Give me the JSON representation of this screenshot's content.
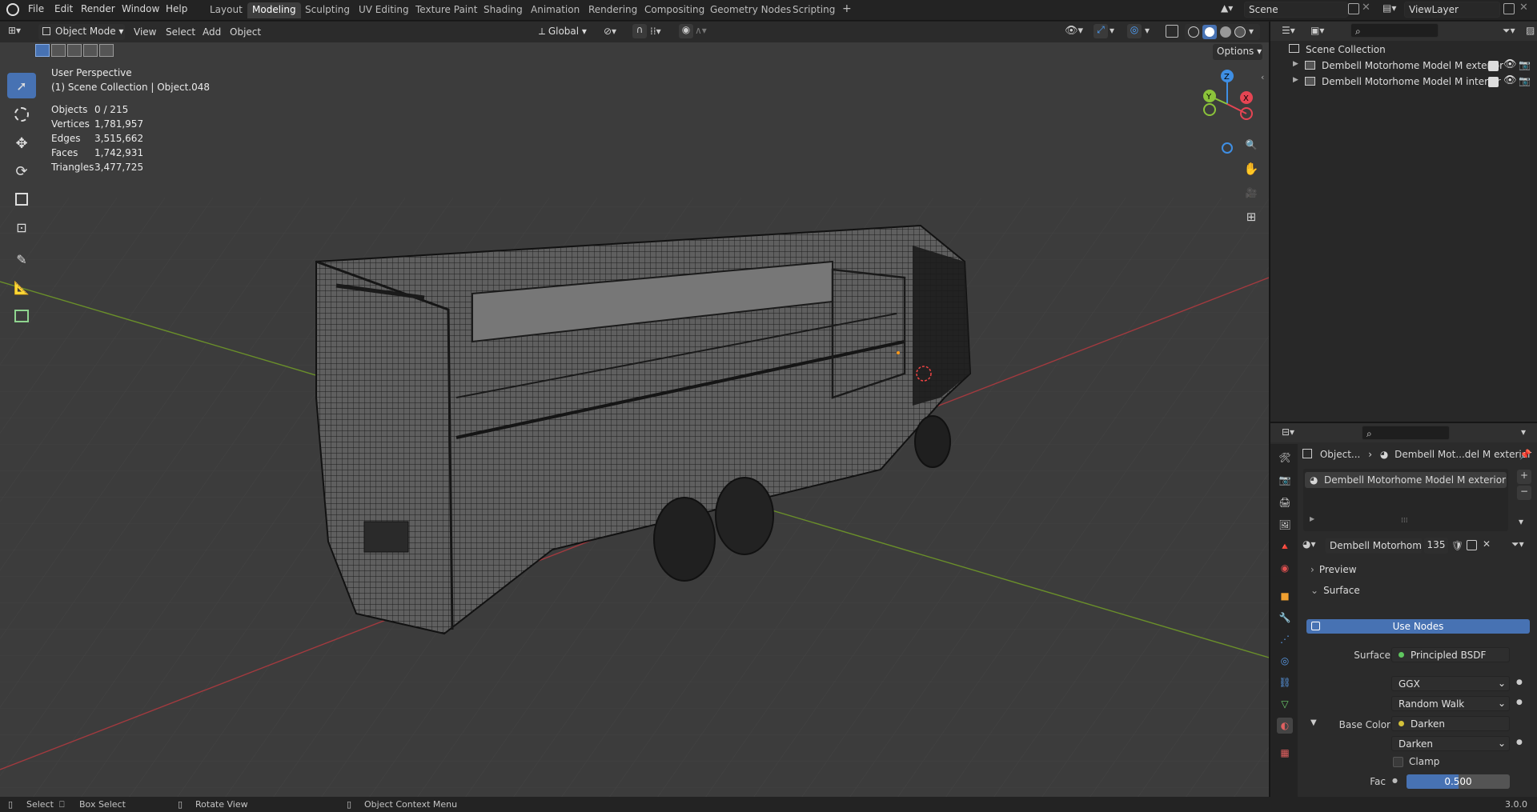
{
  "menubar": {
    "items": [
      "File",
      "Edit",
      "Render",
      "Window",
      "Help"
    ]
  },
  "workspaces": {
    "tabs": [
      "Layout",
      "Modeling",
      "Sculpting",
      "UV Editing",
      "Texture Paint",
      "Shading",
      "Animation",
      "Rendering",
      "Compositing",
      "Geometry Nodes",
      "Scripting"
    ],
    "active": "Modeling",
    "add": "+"
  },
  "scene": {
    "name": "Scene",
    "view_layer": "ViewLayer"
  },
  "viewport_header": {
    "mode": "Object Mode",
    "menus": [
      "View",
      "Select",
      "Add",
      "Object"
    ],
    "orientation": "Global",
    "options": "Options"
  },
  "overlay": {
    "perspective": "User Perspective",
    "collection_path": "(1) Scene Collection | Object.048",
    "stats": [
      {
        "label": "Objects",
        "value": "0 / 215"
      },
      {
        "label": "Vertices",
        "value": "1,781,957"
      },
      {
        "label": "Edges",
        "value": "3,515,662"
      },
      {
        "label": "Faces",
        "value": "1,742,931"
      },
      {
        "label": "Triangles",
        "value": "3,477,725"
      }
    ]
  },
  "gizmo": {
    "z": "Z",
    "y": "Y",
    "x": "X"
  },
  "outliner": {
    "root": "Scene Collection",
    "items": [
      "Dembell Motorhome Model M exterior",
      "Dembell Motorhome Model M  interior"
    ]
  },
  "properties": {
    "breadcrumb_object": "Object...",
    "breadcrumb_material": "Dembell Mot...del M exterior",
    "material_slot": "Dembell Motorhome Model M exterior",
    "material_name": "Dembell Motorhome ...",
    "user_count": "135",
    "preview_label": "Preview",
    "surface_label": "Surface",
    "use_nodes": "Use Nodes",
    "surface_field_label": "Surface",
    "surface_value": "Principled BSDF",
    "distribution": "GGX",
    "subsurface_method": "Random Walk",
    "base_color_label": "Base Color",
    "base_color_value": "Darken",
    "blend_mode": "Darken",
    "clamp_label": "Clamp",
    "fac_label": "Fac",
    "fac_value": "0.500",
    "fac_fraction": 0.5
  },
  "statusbar": {
    "select": "Select",
    "box_select": "Box Select",
    "rotate_view": "Rotate View",
    "context_menu": "Object Context Menu",
    "version": "3.0.0"
  },
  "colors": {
    "accent": "#4772b3",
    "axis_x": "#a23a3f",
    "axis_y": "#6a8f2a",
    "gizmo_x": "#e54553",
    "gizmo_y": "#8bc33a",
    "gizmo_z": "#3f8fe4",
    "viewport_bg": "#3c3c3c"
  }
}
